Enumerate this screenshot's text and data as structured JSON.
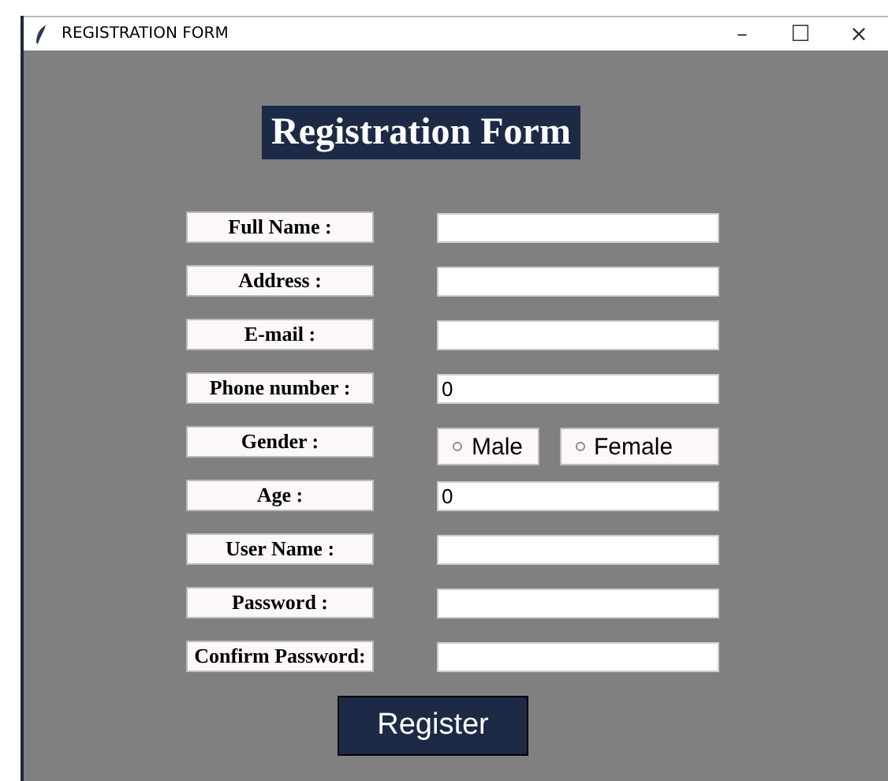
{
  "window": {
    "title": "REGISTRATION FORM",
    "controls": [
      "–",
      "☐",
      "×"
    ]
  },
  "heading": "Registration Form",
  "fields": [
    {
      "label": "Full Name :",
      "kind": "text"
    },
    {
      "label": "Address :",
      "kind": "text"
    },
    {
      "label": "E-mail :",
      "kind": "text"
    },
    {
      "label": "Phone number :",
      "kind": "text",
      "value": "0"
    },
    {
      "label": "Gender :",
      "kind": "radio",
      "options": [
        {
          "label": "Male",
          "selected": false
        },
        {
          "label": "Female",
          "selected": false
        }
      ]
    },
    {
      "label": "Age :",
      "kind": "text",
      "value": "0"
    },
    {
      "label": "User Name :",
      "kind": "text"
    },
    {
      "label": "Password :",
      "kind": "text"
    },
    {
      "label": "Confirm Password:",
      "kind": "text"
    }
  ],
  "button": "Register"
}
